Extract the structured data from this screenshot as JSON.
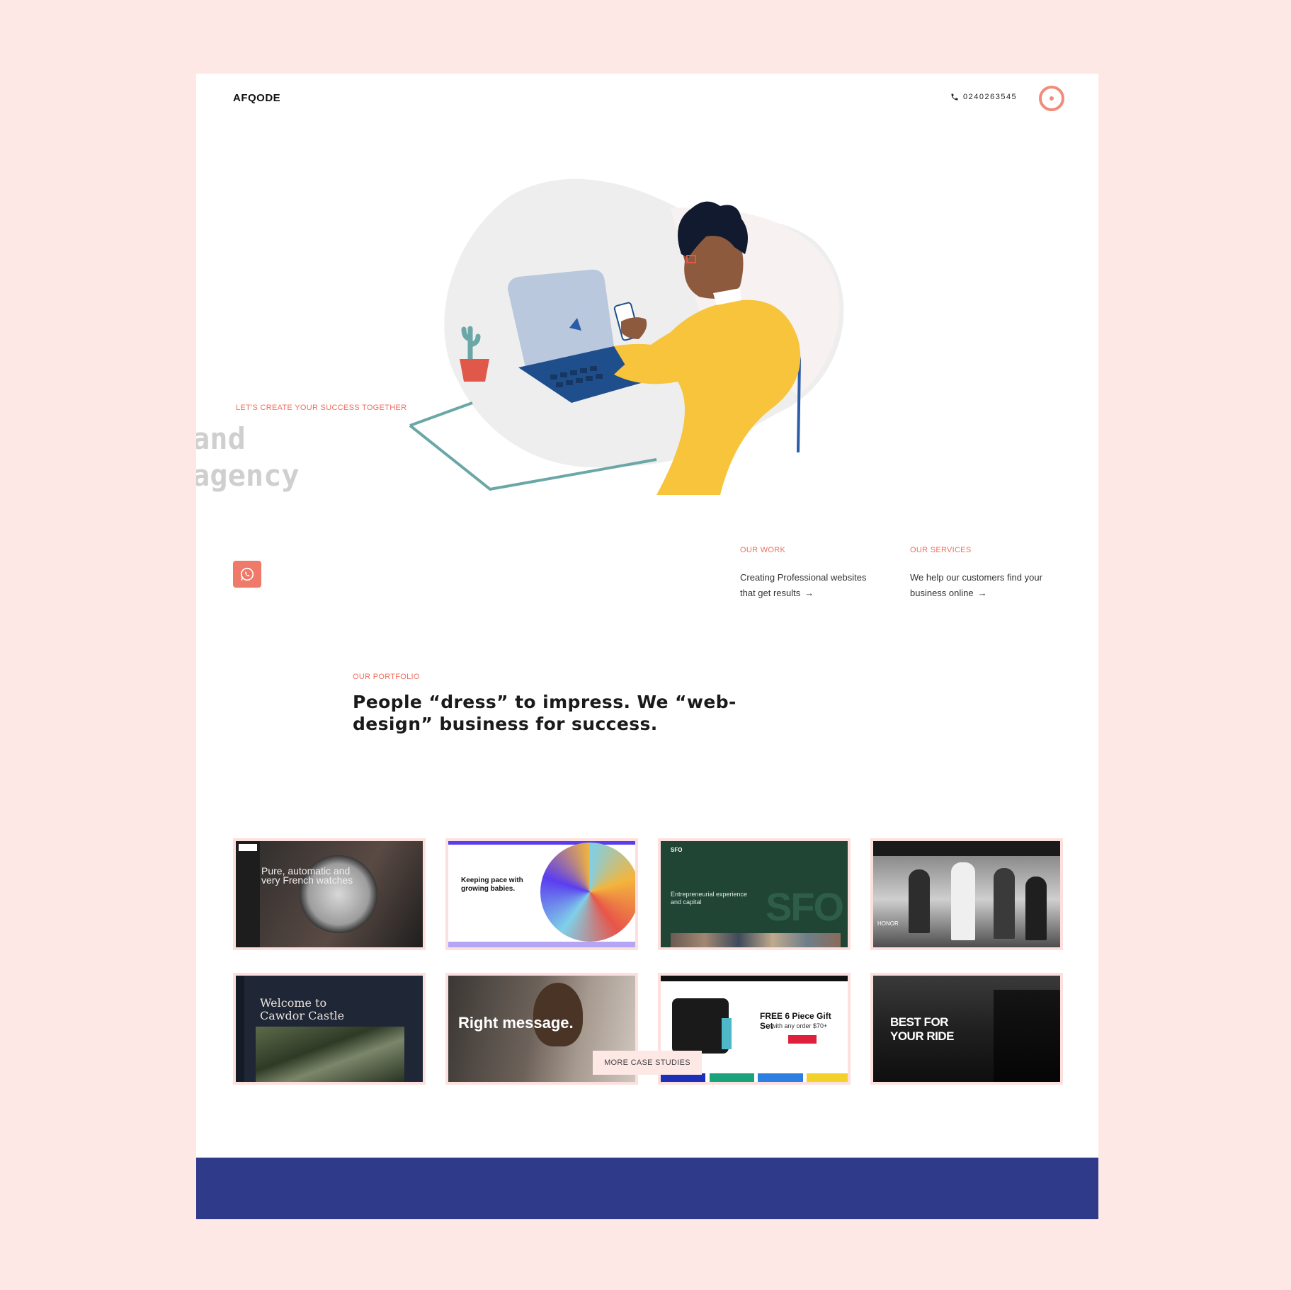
{
  "header": {
    "logo": "AFQODE",
    "phone": "0240263545"
  },
  "hero": {
    "tagline": "LET'S CREATE YOUR SUCCESS TOGETHER",
    "headline_line1": "and",
    "headline_line2": "agency"
  },
  "info": {
    "work": {
      "label": "OUR WORK",
      "text": "Creating Professional websites that get results",
      "arrow": "→"
    },
    "services": {
      "label": "OUR SERVICES",
      "text": "We help our customers find your business online",
      "arrow": "→"
    }
  },
  "portfolio": {
    "label": "OUR PORTFOLIO",
    "title": "People “dress” to impress. We “web-design” business for success.",
    "cards": [
      {
        "caption": "Pure, automatic and very French watches"
      },
      {
        "caption": "Keeping pace with growing babies."
      },
      {
        "caption": "Entrepreneurial experience and capital",
        "brand": "SFO"
      },
      {
        "caption": "HONOR"
      },
      {
        "caption": "Welcome to Cawdor Castle"
      },
      {
        "caption": "Right message."
      },
      {
        "caption": "FREE 6 Piece Gift Set",
        "sub": "with any order $70+"
      },
      {
        "caption": "BEST FOR YOUR RIDE"
      }
    ],
    "more_button": "MORE CASE STUDIES"
  },
  "colors": {
    "accent": "#f06d5e",
    "footer": "#2f3a8a",
    "background": "#fde8e6"
  }
}
